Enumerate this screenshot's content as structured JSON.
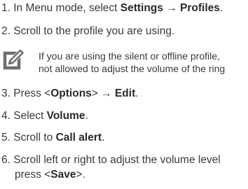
{
  "steps": [
    {
      "num": "1.",
      "pre": "In Menu mode, select ",
      "b1": "Settings",
      "arrow": " → ",
      "b2": "Profiles",
      "post": "."
    },
    {
      "num": "2.",
      "text": "Scroll to the profile you are using."
    },
    {
      "num": "3.",
      "pre": "Press <",
      "b1": "Options",
      "mid": "> → ",
      "b2": "Edit",
      "post": "."
    },
    {
      "num": "4.",
      "pre": "Select ",
      "b1": "Volume",
      "post": "."
    },
    {
      "num": "5.",
      "pre": "Scroll to ",
      "b1": "Call alert",
      "post": "."
    },
    {
      "num": "6.",
      "line1": "Scroll left or right to adjust the volume level",
      "line2_pre": "press <",
      "line2_b": "Save",
      "line2_post": ">."
    }
  ],
  "note": {
    "icon": "note-pencil-icon",
    "line1": "If you are using the silent or offline profile,",
    "line2": "not allowed to adjust the volume of the ring"
  }
}
